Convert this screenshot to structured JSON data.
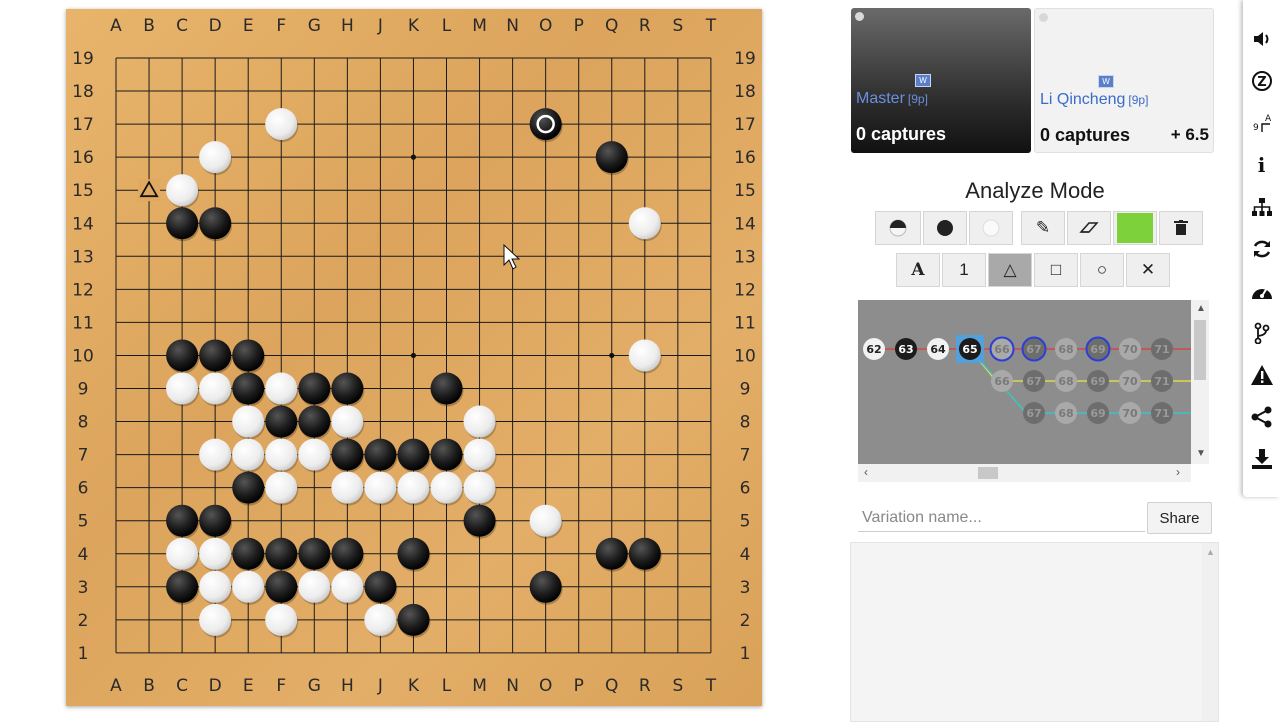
{
  "board": {
    "columns": [
      "A",
      "B",
      "C",
      "D",
      "E",
      "F",
      "G",
      "H",
      "J",
      "K",
      "L",
      "M",
      "N",
      "O",
      "P",
      "Q",
      "R",
      "S",
      "T"
    ],
    "rows": [
      "19",
      "18",
      "17",
      "16",
      "15",
      "14",
      "13",
      "12",
      "11",
      "10",
      "9",
      "8",
      "7",
      "6",
      "5",
      "4",
      "3",
      "2",
      "1"
    ],
    "hoshi": [
      "K16",
      "K10",
      "Q10"
    ],
    "black_stones": [
      "O17",
      "Q16",
      "C14",
      "D14",
      "C10",
      "D10",
      "E10",
      "E9",
      "G9",
      "H9",
      "L9",
      "F8",
      "G8",
      "H7",
      "J7",
      "K7",
      "L7",
      "E6",
      "M5",
      "C5",
      "D5",
      "E4",
      "F4",
      "G4",
      "H4",
      "K4",
      "Q4",
      "R4",
      "C3",
      "F3",
      "J3",
      "O3",
      "K2"
    ],
    "white_stones": [
      "F17",
      "D16",
      "C15",
      "R14",
      "R10",
      "C9",
      "D9",
      "F9",
      "E8",
      "H8",
      "M8",
      "D7",
      "E7",
      "F7",
      "G7",
      "M7",
      "F6",
      "H6",
      "J6",
      "K6",
      "L6",
      "M6",
      "O5",
      "C4",
      "D4",
      "D3",
      "E3",
      "G3",
      "H3",
      "D2",
      "F2",
      "J2"
    ],
    "last_move": "O17",
    "triangle_mark": "B15"
  },
  "players": {
    "black": {
      "name": "Master",
      "rank": "[9p]",
      "captures": "0 captures"
    },
    "white": {
      "name": "Li Qincheng",
      "rank": "[9p]",
      "captures": "0 captures",
      "komi": "+ 6.5"
    }
  },
  "analyze": {
    "title": "Analyze Mode",
    "tools_row1": [
      "alternate-stone",
      "black-stone",
      "white-stone",
      "pencil",
      "eraser",
      "color-swatch",
      "trash"
    ],
    "tools_row2_labels": [
      "A",
      "1",
      "△",
      "□",
      "○",
      "✕"
    ],
    "active_tool": "triangle",
    "swatch_color": "#7dd13b"
  },
  "tree": {
    "main": [
      {
        "n": "62",
        "c": "white"
      },
      {
        "n": "63",
        "c": "black"
      },
      {
        "n": "64",
        "c": "white"
      },
      {
        "n": "65",
        "c": "black",
        "current": true
      },
      {
        "n": "66",
        "c": "white",
        "ring": true
      },
      {
        "n": "67",
        "c": "black",
        "ring": true
      },
      {
        "n": "68",
        "c": "white"
      },
      {
        "n": "69",
        "c": "black",
        "ring": true
      },
      {
        "n": "70",
        "c": "white"
      },
      {
        "n": "71",
        "c": "black"
      }
    ],
    "var1": [
      "66",
      "67",
      "68",
      "69",
      "70",
      "71"
    ],
    "var2": [
      "67",
      "68",
      "69",
      "70",
      "71"
    ]
  },
  "variation": {
    "placeholder": "Variation name...",
    "share_label": "Share"
  }
}
